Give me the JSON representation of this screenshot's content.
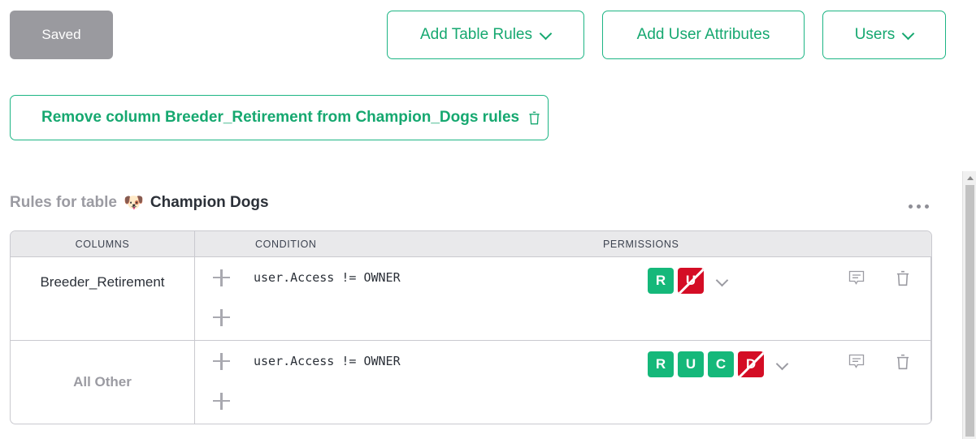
{
  "toolbar": {
    "saved_label": "Saved",
    "add_table_rules_label": "Add Table Rules",
    "add_user_attributes_label": "Add User Attributes",
    "users_label": "Users",
    "chevron_icon": "chevron-down-icon",
    "saved_bg_color": "#9a9a9f",
    "accent_color": "#16a870"
  },
  "remove_column": {
    "label": "Remove column Breeder_Retirement from Champion_Dogs rules",
    "trash_icon": "trash-icon"
  },
  "section": {
    "prefix_label": "Rules for table",
    "table_emoji": "🐶",
    "table_name": "Champion Dogs",
    "more_menu_icon": "ellipsis-icon"
  },
  "table": {
    "headers": [
      "COLUMNS",
      "CONDITION",
      "PERMISSIONS"
    ],
    "rows": [
      {
        "column": "Breeder_Retirement",
        "column_style": "normal",
        "condition": "user.Access != OWNER",
        "permissions": [
          {
            "letter": "R",
            "state": "allowed"
          },
          {
            "letter": "U",
            "state": "denied"
          }
        ],
        "actions": [
          "comment-icon",
          "trash-icon"
        ]
      },
      {
        "column": "All Other",
        "column_style": "muted-bold",
        "condition": "user.Access != OWNER",
        "permissions": [
          {
            "letter": "R",
            "state": "allowed"
          },
          {
            "letter": "U",
            "state": "allowed"
          },
          {
            "letter": "C",
            "state": "allowed"
          },
          {
            "letter": "D",
            "state": "denied"
          }
        ],
        "actions": [
          "comment-icon",
          "trash-icon"
        ]
      }
    ],
    "add_condition_icon": "plus-icon",
    "expand_icon": "chevron-down-icon",
    "allowed_color": "#15b87a",
    "denied_color": "#d40d25"
  },
  "scrollbar": {
    "up_arrow_icon": "scroll-up-arrow-icon"
  }
}
